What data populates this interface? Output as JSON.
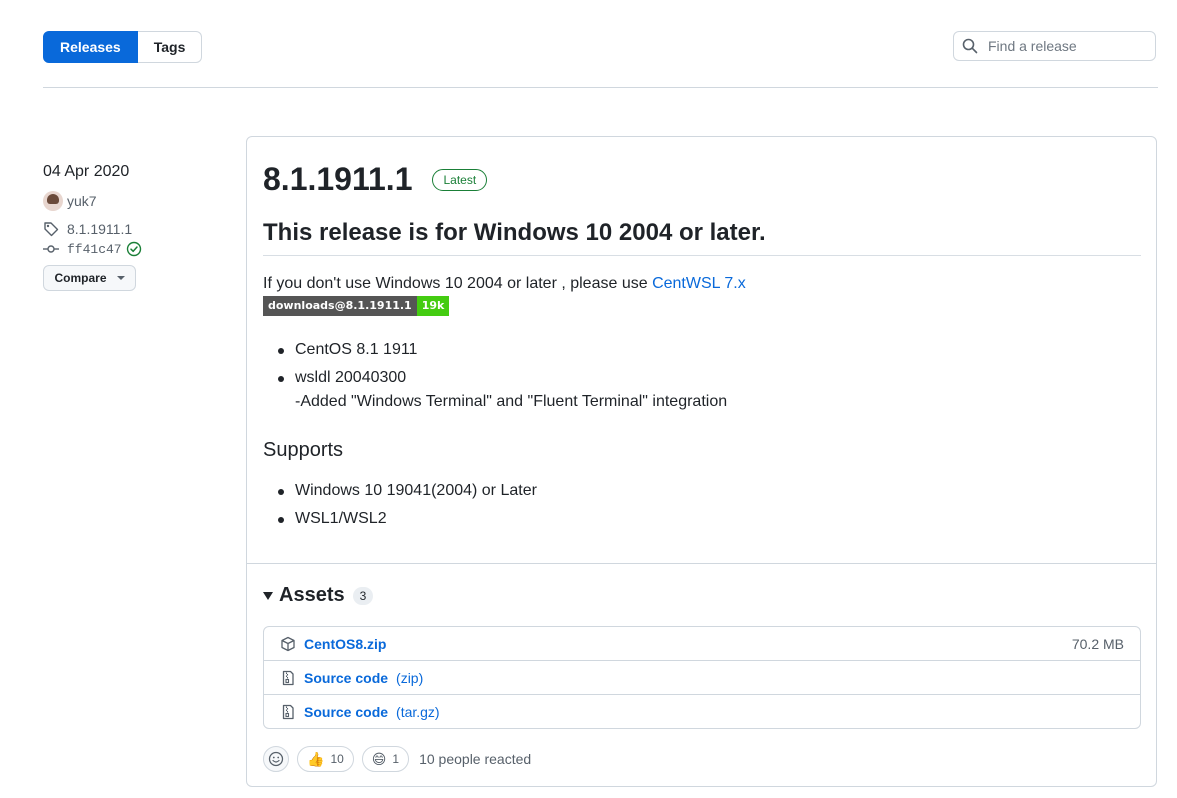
{
  "tabs": {
    "releases": "Releases",
    "tags": "Tags"
  },
  "search": {
    "placeholder": "Find a release"
  },
  "meta": {
    "date": "04 Apr 2020",
    "author": "yuk7",
    "tag": "8.1.1911.1",
    "commit": "ff41c47",
    "compare": "Compare"
  },
  "release": {
    "title": "8.1.1911.1",
    "latest_label": "Latest",
    "heading": "This release is for Windows 10 2004 or later.",
    "para_prefix": "If you don't use Windows 10 2004 or later , please use ",
    "para_link": "CentWSL 7.x",
    "badge_left": "downloads@8.1.1911.1",
    "badge_right": "19k",
    "items": [
      {
        "line1": "CentOS 8.1 1911",
        "line2": ""
      },
      {
        "line1": "wsldl 20040300",
        "line2": "-Added \"Windows Terminal\" and \"Fluent Terminal\" integration"
      }
    ],
    "supports_heading": "Supports",
    "supports": [
      "Windows 10 19041(2004) or Later",
      "WSL1/WSL2"
    ]
  },
  "assets": {
    "title": "Assets",
    "count": "3",
    "items": [
      {
        "name": "CentOS8.zip",
        "ext": "",
        "size": "70.2 MB"
      },
      {
        "name": "Source code",
        "ext": "(zip)",
        "size": ""
      },
      {
        "name": "Source code",
        "ext": "(tar.gz)",
        "size": ""
      }
    ]
  },
  "reactions": {
    "thumbs_count": "10",
    "laugh_count": "1",
    "summary": "10 people reacted"
  },
  "colors": {
    "accent": "#0969da",
    "latest": "#1a7f37",
    "badge_green": "#44cc11"
  }
}
